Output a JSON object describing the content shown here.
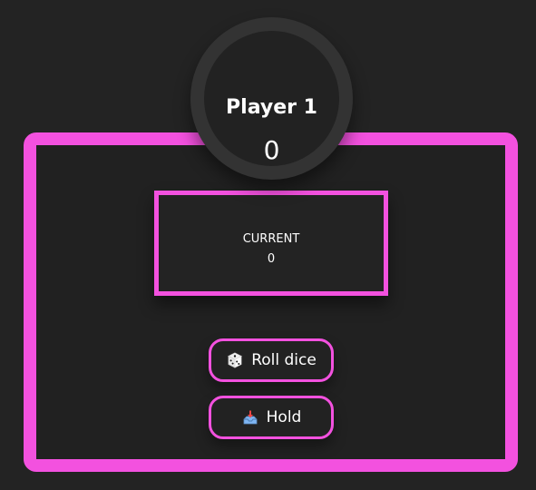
{
  "player": {
    "name": "Player 1",
    "score": "0"
  },
  "current": {
    "label": "CURRENT",
    "value": "0"
  },
  "actions": {
    "roll_label": "Roll dice",
    "roll_icon": "dice-icon",
    "hold_label": "Hold",
    "hold_icon": "inbox-tray-icon"
  },
  "colors": {
    "accent": "#f351df",
    "background": "#232323",
    "text": "#ffffff"
  }
}
